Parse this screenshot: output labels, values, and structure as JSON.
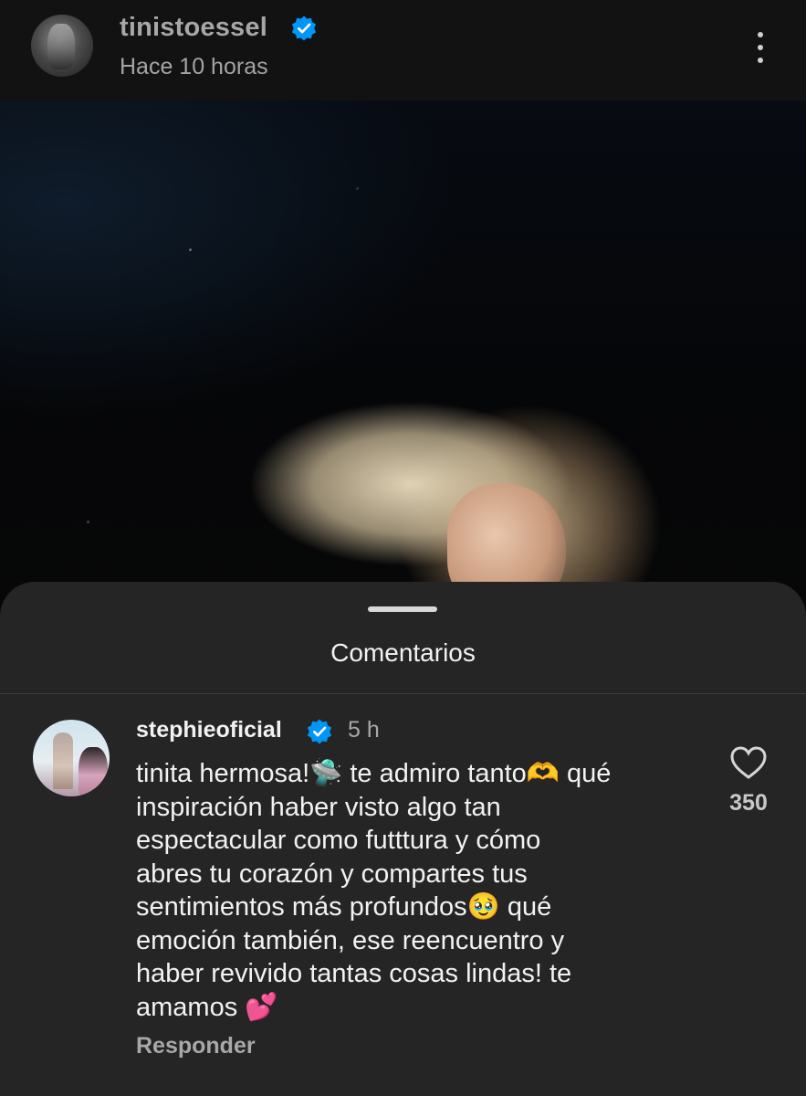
{
  "post": {
    "username": "tinistoessel",
    "time": "Hace 10 horas",
    "verified": true,
    "icons": [
      "verified-badge-icon",
      "more-options-icon"
    ]
  },
  "comments_sheet": {
    "title": "Comentarios",
    "comment": {
      "username": "stephieoficial",
      "verified": true,
      "time": "5 h",
      "text": "tinita hermosa!🛸 te admiro tanto🫶 qué\ninspiración haber visto algo tan\nespectacular como futttura y cómo\nabres tu corazón y compartes tus\nsentimientos más profundos🥹 qué\nemoción también, ese reencuentro y\nhaber revivido tantas cosas lindas! te\namamos 💕",
      "likes": "350",
      "reply_label": "Responder"
    }
  },
  "colors": {
    "background": "#0c0c0c",
    "sheet": "#252525",
    "verified_blue": "#0095f6",
    "text_primary": "#f2f2f2",
    "text_secondary": "#a8a8a8"
  }
}
